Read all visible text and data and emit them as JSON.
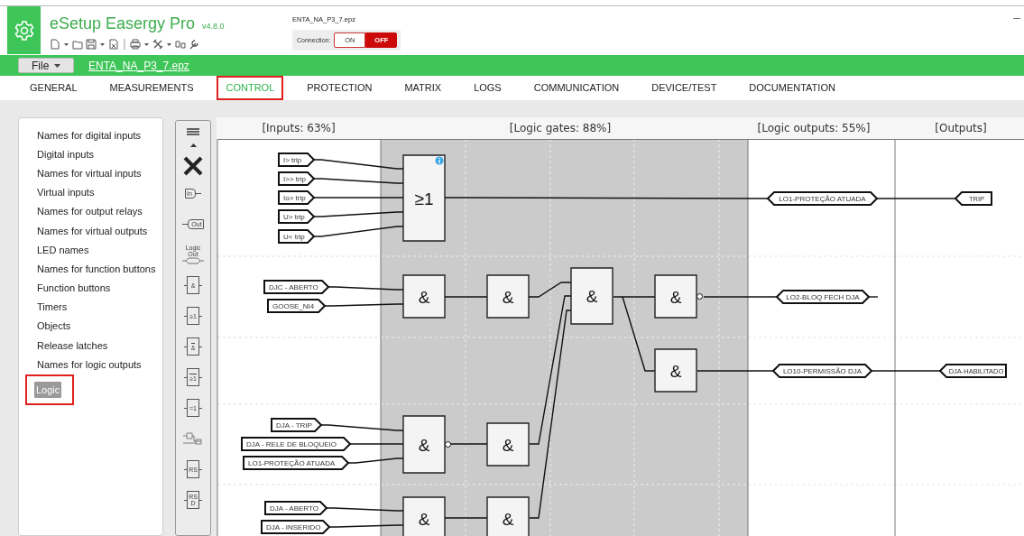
{
  "app": {
    "title": "eSetup Easergy Pro",
    "version": "v4.8.0",
    "file_caption": "ENTA_NA_P3_7.epz"
  },
  "connection": {
    "label": "Connection:",
    "options": [
      {
        "label": "ON",
        "selected": false
      },
      {
        "label": "OFF",
        "selected": true
      }
    ]
  },
  "file_bar": {
    "menu": "File",
    "file_link": "ENTA_NA_P3_7.epz"
  },
  "tabs": [
    {
      "label": "GENERAL",
      "selected": false
    },
    {
      "label": "MEASUREMENTS",
      "selected": false
    },
    {
      "label": "CONTROL",
      "selected": true
    },
    {
      "label": "PROTECTION",
      "selected": false
    },
    {
      "label": "MATRIX",
      "selected": false
    },
    {
      "label": "LOGS",
      "selected": false
    },
    {
      "label": "COMMUNICATION",
      "selected": false
    },
    {
      "label": "DEVICE/TEST",
      "selected": false
    },
    {
      "label": "DOCUMENTATION",
      "selected": false
    }
  ],
  "sidebar": {
    "items": [
      {
        "label": "Names for digital inputs",
        "selected": false
      },
      {
        "label": "Digital inputs",
        "selected": false
      },
      {
        "label": "Names for virtual inputs",
        "selected": false
      },
      {
        "label": "Virtual inputs",
        "selected": false
      },
      {
        "label": "Names for output relays",
        "selected": false
      },
      {
        "label": "Names for virtual outputs",
        "selected": false
      },
      {
        "label": "LED names",
        "selected": false
      },
      {
        "label": "Names for function buttons",
        "selected": false
      },
      {
        "label": "Function buttons",
        "selected": false
      },
      {
        "label": "Timers",
        "selected": false
      },
      {
        "label": "Objects",
        "selected": false
      },
      {
        "label": "Release latches",
        "selected": false
      },
      {
        "label": "Names for logic outputs",
        "selected": false
      },
      {
        "label": "Logic",
        "selected": true
      }
    ]
  },
  "palette": [
    {
      "kind": "input",
      "label": "In"
    },
    {
      "kind": "output",
      "label": "Out"
    },
    {
      "kind": "logic_output",
      "label": "Logic Out"
    },
    {
      "kind": "gate",
      "label": "&"
    },
    {
      "kind": "gate",
      "label": "≥1"
    },
    {
      "kind": "gate_inverted",
      "label": "&"
    },
    {
      "kind": "gate_inverted",
      "label": "≥1"
    },
    {
      "kind": "gate",
      "label": "=1"
    },
    {
      "kind": "delay"
    },
    {
      "kind": "gate",
      "label": "RS"
    },
    {
      "kind": "gate",
      "label": "RS D"
    }
  ],
  "diagram": {
    "column_headers": [
      "[Inputs: 63%]",
      "[Logic gates: 88%]",
      "[Logic outputs: 55%]",
      "[Outputs]"
    ],
    "inputs": [
      "I> trip",
      "I>> trip",
      "Io> trip",
      "U> trip",
      "U< trip",
      "DJC - ABERTO",
      "GOOSE_NI4",
      "DJA - TRIP",
      "DJA - RELE DE BLOQUEIO",
      "LO1-PROTEÇÃO ATUADA",
      "DJA - ABERTO",
      "DJA - INSERIDO"
    ],
    "gates": [
      {
        "symbol": "≥1",
        "negated": false,
        "info": true
      },
      {
        "symbol": "&",
        "negated": false,
        "info": false
      },
      {
        "symbol": "&",
        "negated": false,
        "info": false
      },
      {
        "symbol": "&",
        "negated": false,
        "info": false
      },
      {
        "symbol": "&",
        "negated": true,
        "info": false
      },
      {
        "symbol": "&",
        "negated": false,
        "info": false
      },
      {
        "symbol": "&",
        "negated": true,
        "info": false
      },
      {
        "symbol": "&",
        "negated": false,
        "info": false
      },
      {
        "symbol": "&",
        "negated": false,
        "info": false
      },
      {
        "symbol": "&",
        "negated": false,
        "info": false
      }
    ],
    "logic_outputs": [
      "LO1-PROTEÇÃO ATUADA",
      "LO2-BLOQ FECH DJA",
      "LO10-PERMISSÃO DJA"
    ],
    "outputs": [
      "TRIP",
      "DJA-HABILITADO"
    ]
  }
}
